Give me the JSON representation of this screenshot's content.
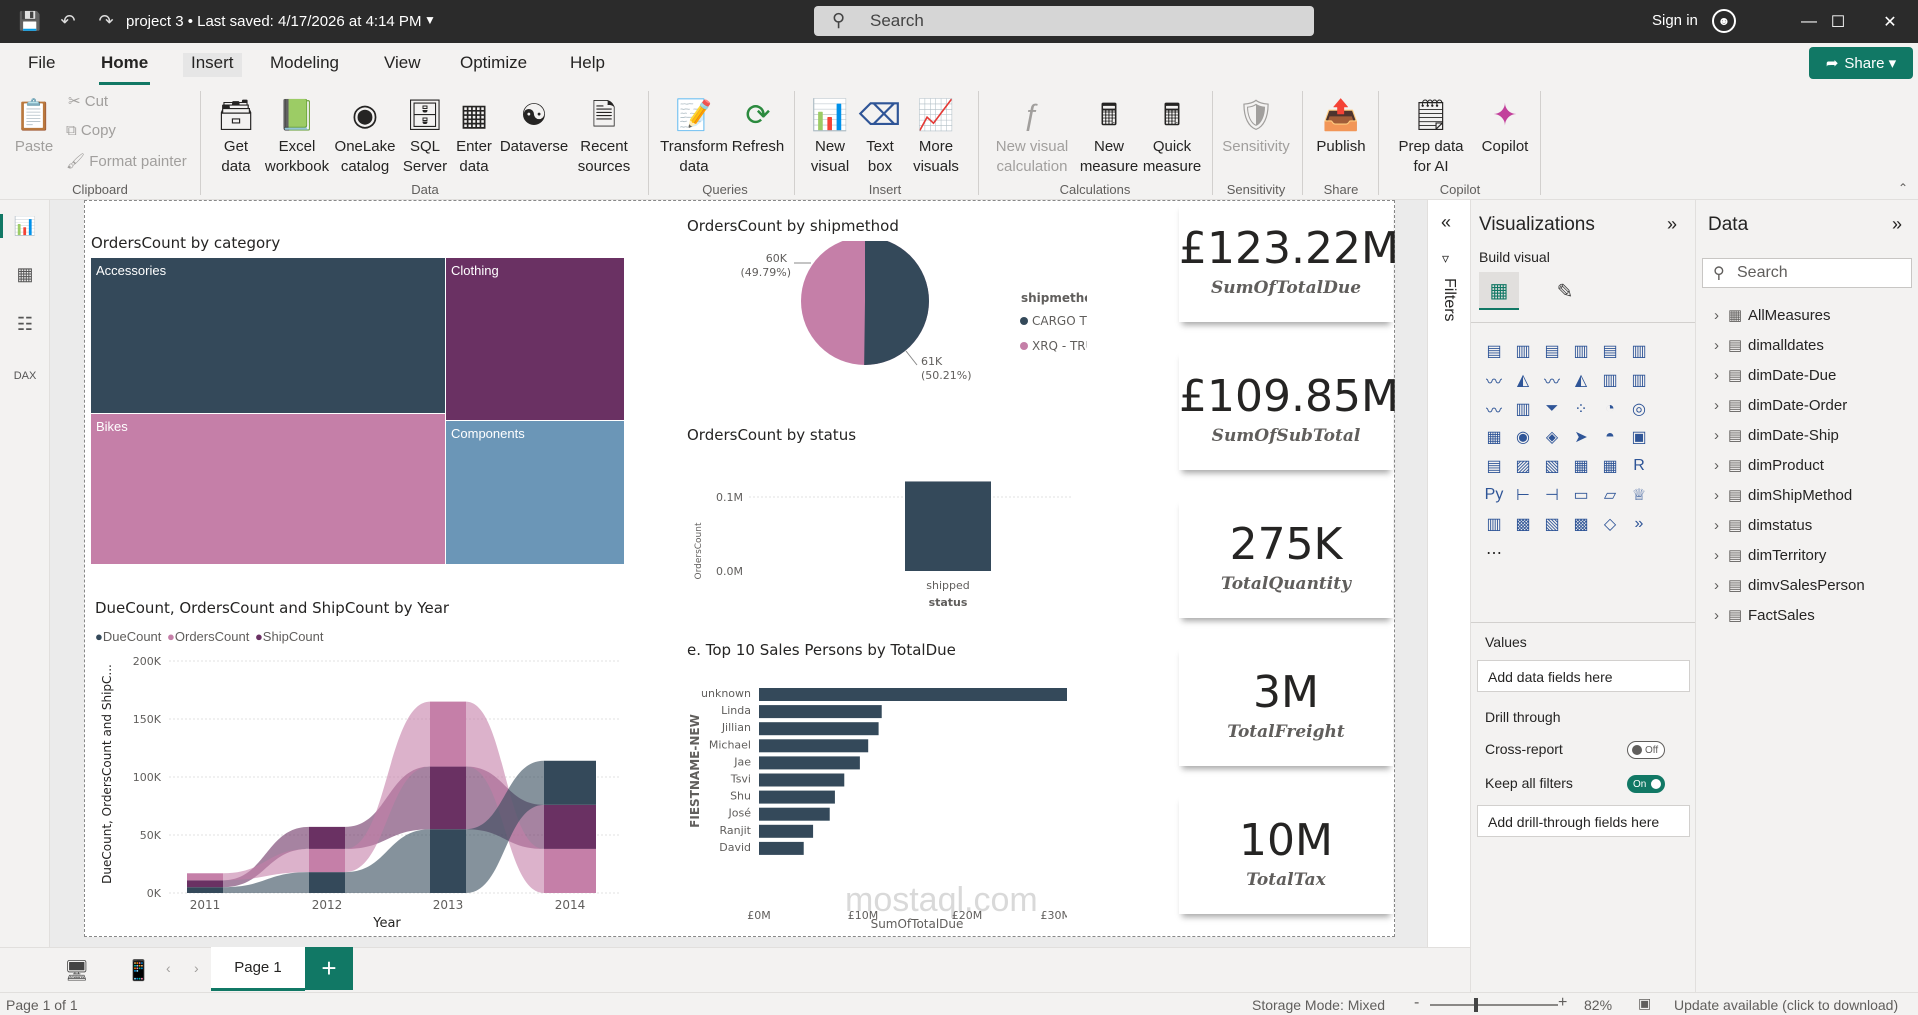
{
  "titlebar": {
    "title": "project 3 • Last saved: 4/17/2026 at 4:14 PM",
    "search_placeholder": "Search",
    "signin": "Sign in"
  },
  "tabs": [
    "File",
    "Home",
    "Insert",
    "Modeling",
    "View",
    "Optimize",
    "Help"
  ],
  "active_tab": "Home",
  "share": "Share",
  "ribbon": {
    "clipboard": {
      "paste": "Paste",
      "cut": "Cut",
      "copy": "Copy",
      "format_painter": "Format painter",
      "label": "Clipboard"
    },
    "data": {
      "get_data": "Get data",
      "excel": "Excel workbook",
      "onelake": "OneLake catalog",
      "sql": "SQL Server",
      "enter": "Enter data",
      "dataverse": "Dataverse",
      "recent": "Recent sources",
      "label": "Data"
    },
    "queries": {
      "transform": "Transform data",
      "refresh": "Refresh",
      "label": "Queries"
    },
    "insert": {
      "new_visual": "New visual",
      "text_box": "Text box",
      "more_visuals": "More visuals",
      "label": "Insert"
    },
    "calculations": {
      "new_visual_calc": "New visual calculation",
      "new_measure": "New measure",
      "quick_measure": "Quick measure",
      "label": "Calculations"
    },
    "sensitivity": {
      "sensitivity": "Sensitivity",
      "label": "Sensitivity"
    },
    "share_group": {
      "publish": "Publish",
      "label": "Share"
    },
    "copilot": {
      "prep": "Prep data for AI",
      "copilot": "Copilot",
      "label": "Copilot"
    }
  },
  "treemap": {
    "title": "OrdersCount by category",
    "cells": [
      {
        "label": "Accessories",
        "color": "#34495a"
      },
      {
        "label": "Clothing",
        "color": "#6a3163"
      },
      {
        "label": "Bikes",
        "color": "#c57fa8"
      },
      {
        "label": "Components",
        "color": "#6b96b7"
      }
    ]
  },
  "pie": {
    "title": "OrdersCount by shipmethod",
    "legend_title": "shipmethod",
    "slices": [
      {
        "name": "CARGO TRANSPO...",
        "value": "61K",
        "pct": "(50.21%)",
        "share": 50.21,
        "color": "#34495a"
      },
      {
        "name": "XRQ - TRUCK GR...",
        "value": "60K",
        "pct": "(49.79%)",
        "share": 49.79,
        "color": "#c57fa8"
      }
    ]
  },
  "status_chart": {
    "title": "OrdersCount by status",
    "ylabel": "OrdersCount",
    "xlabel": "status",
    "yticks": [
      "0.1M",
      "0.0M"
    ],
    "category": "shipped",
    "value": 0.121
  },
  "ribbon_chart": {
    "title": "DueCount, OrdersCount and ShipCount by Year",
    "legend": [
      {
        "name": "DueCount",
        "color": "#34495a"
      },
      {
        "name": "OrdersCount",
        "color": "#c57fa8"
      },
      {
        "name": "ShipCount",
        "color": "#6a3163"
      }
    ],
    "ylabel": "DueCount, OrdersCount and ShipC...",
    "xlabel": "Year",
    "yticks": [
      "200K",
      "150K",
      "100K",
      "50K",
      "0K"
    ],
    "years": [
      "2011",
      "2012",
      "2013",
      "2014"
    ]
  },
  "bar_chart": {
    "title": "e. Top 10 Sales Persons by TotalDue",
    "ylabel": "FIESTNAME-NEW",
    "xlabel": "SumOfTotalDue",
    "xticks": [
      "£0M",
      "£10M",
      "£20M",
      "£30M"
    ]
  },
  "chart_data": [
    {
      "type": "bar",
      "title": "e. Top 10 Sales Persons by TotalDue",
      "categories": [
        "unknown",
        "Linda",
        "Jillian",
        "Michael",
        "Jae",
        "Tsvi",
        "Shu",
        "José",
        "Ranjit",
        "David"
      ],
      "values": [
        32.7,
        11.8,
        11.5,
        10.5,
        9.7,
        8.2,
        7.3,
        6.8,
        5.2,
        4.3
      ],
      "xlabel": "SumOfTotalDue",
      "ylabel": "FIESTNAME-NEW",
      "xlim": [
        0,
        35
      ]
    },
    {
      "type": "area",
      "title": "DueCount, OrdersCount and ShipCount by Year",
      "categories": [
        "2011",
        "2012",
        "2013",
        "2014"
      ],
      "series": [
        {
          "name": "DueCount",
          "values": [
            5,
            18,
            55,
            38
          ]
        },
        {
          "name": "OrdersCount",
          "values": [
            6,
            20,
            56,
            38
          ]
        },
        {
          "name": "ShipCount",
          "values": [
            6,
            19,
            54,
            38
          ]
        }
      ],
      "ylim": [
        0,
        200
      ]
    }
  ],
  "cards": [
    {
      "value": "£123.22M",
      "label": "SumOfTotalDue"
    },
    {
      "value": "£109.85M",
      "label": "SumOfSubTotal"
    },
    {
      "value": "275K",
      "label": "TotalQuantity"
    },
    {
      "value": "3M",
      "label": "TotalFreight"
    },
    {
      "value": "10M",
      "label": "TotalTax"
    }
  ],
  "filters_label": "Filters",
  "visualizations": {
    "title": "Visualizations",
    "build": "Build visual",
    "values": "Values",
    "add_values": "Add data fields here",
    "drill": "Drill through",
    "cross_report": "Cross-report",
    "cross_state": "Off",
    "keep_filters": "Keep all filters",
    "keep_state": "On",
    "add_drill": "Add drill-through fields here"
  },
  "data_pane": {
    "title": "Data",
    "search_placeholder": "Search",
    "tables": [
      "AllMeasures",
      "dimalldates",
      "dimDate-Due",
      "dimDate-Order",
      "dimDate-Ship",
      "dimProduct",
      "dimShipMethod",
      "dimstatus",
      "dimTerritory",
      "dimvSalesPerson",
      "FactSales"
    ]
  },
  "page_tab": "Page 1",
  "status": {
    "page": "Page 1 of 1",
    "storage": "Storage Mode: Mixed",
    "zoom": "82%",
    "update": "Update available (click to download)"
  }
}
